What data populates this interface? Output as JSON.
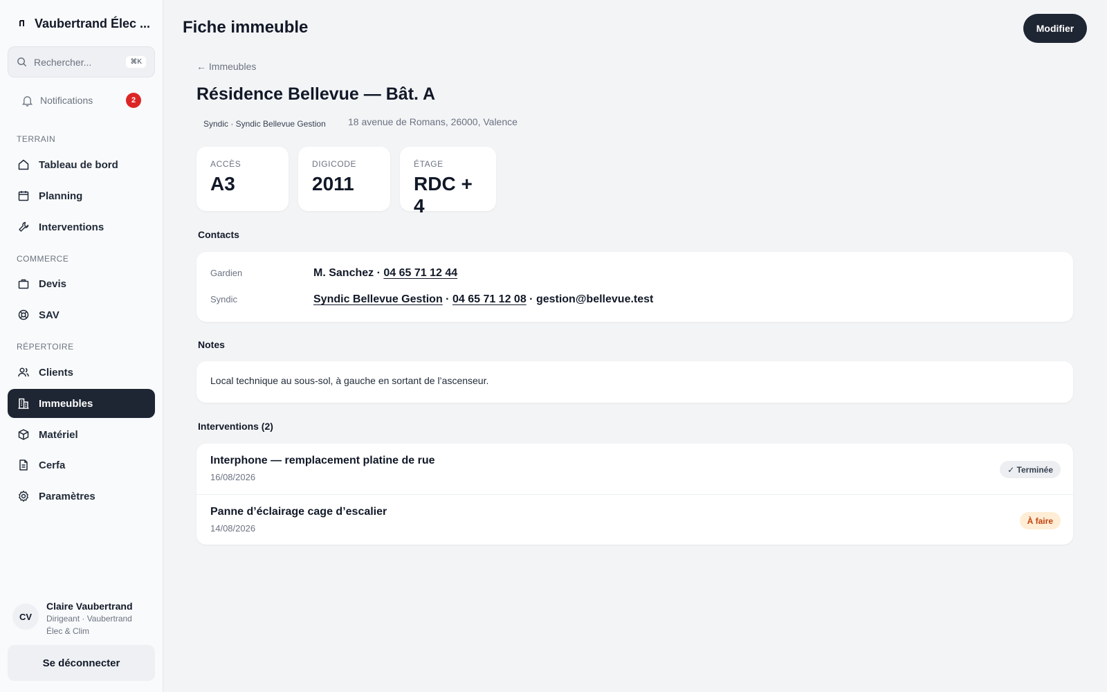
{
  "sidebar": {
    "brand": "Vaubertrand Élec ...",
    "search": {
      "placeholder": "Rechercher...",
      "shortcut": "⌘K"
    },
    "notifications": {
      "label": "Notifications",
      "count": "2"
    },
    "sections": {
      "terrain": "TERRAIN",
      "commerce": "COMMERCE",
      "repertoire": "RÉPERTOIRE"
    },
    "items": {
      "tableau": "Tableau de bord",
      "planning": "Planning",
      "interventions": "Interventions",
      "devis": "Devis",
      "sav": "SAV",
      "clients": "Clients",
      "immeubles": "Immeubles",
      "materiel": "Matériel",
      "cerfa": "Cerfa",
      "parametres": "Paramètres"
    },
    "active_item": "Immeubles",
    "user": {
      "initials": "CV",
      "name": "Claire Vaubertrand",
      "role": "Dirigeant · Vaubertrand Élec & Clim"
    },
    "logout": "Se déconnecter"
  },
  "header": {
    "title": "Fiche immeuble",
    "edit_button": "Modifier"
  },
  "building": {
    "back": "← Immeubles",
    "name": "Résidence Bellevue — Bât. A",
    "syndic_chip": "Syndic · Syndic Bellevue Gestion",
    "address": "18 avenue de Romans, 26000, Valence",
    "stats": [
      {
        "label": "ACCÈS",
        "value": "A3"
      },
      {
        "label": "DIGICODE",
        "value": "2011"
      },
      {
        "label": "ÉTAGE",
        "value": "RDC + 4"
      }
    ]
  },
  "contacts": {
    "title": "Contacts",
    "gardien": {
      "label": "Gardien",
      "name": "M. Sanchez",
      "phone": "04 65 71 12 44"
    },
    "syndic": {
      "label": "Syndic",
      "name": "Syndic Bellevue Gestion",
      "phone": "04 65 71 12 08",
      "email": "gestion@bellevue.test"
    },
    "separator": " · "
  },
  "notes": {
    "title": "Notes",
    "text": "Local technique au sous-sol, à gauche en sortant de l’ascenseur."
  },
  "interventions": {
    "title": "Interventions (2)",
    "items": [
      {
        "title": "Interphone — remplacement platine de rue",
        "date": "16/08/2026",
        "status": "✓ Terminée"
      },
      {
        "title": "Panne d’éclairage cage d’escalier",
        "date": "14/08/2026",
        "status": "À faire"
      }
    ]
  },
  "colors": {
    "primary_dark": "#1e2533",
    "badge_red": "#dc2626",
    "status_todo_bg": "#ffedd5",
    "status_todo_text": "#c2410c"
  }
}
